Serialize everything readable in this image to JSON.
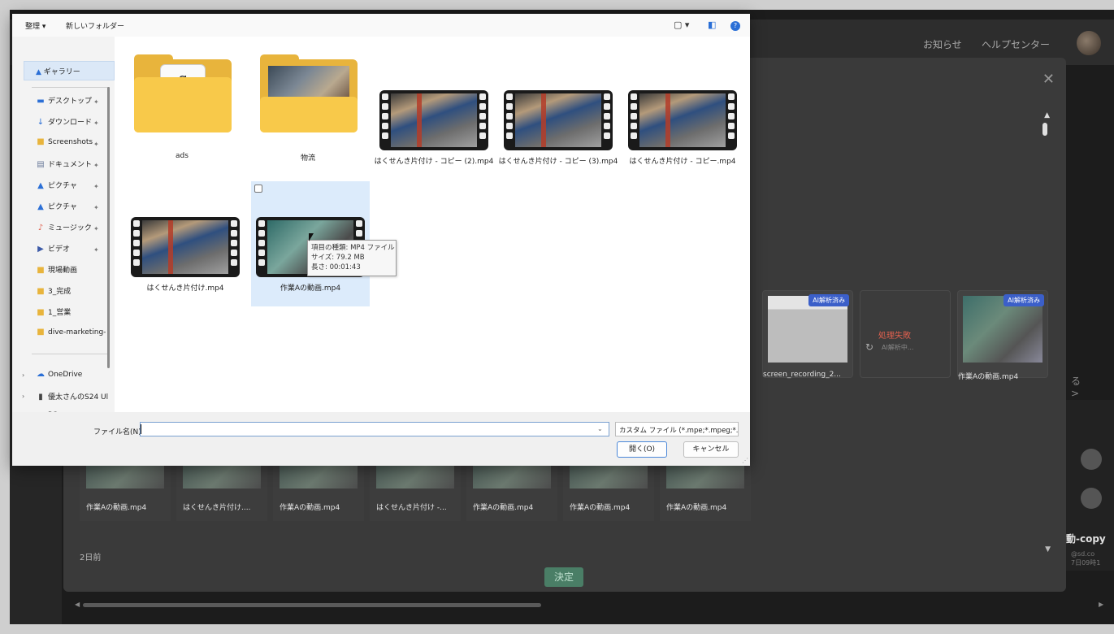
{
  "background_app": {
    "header": {
      "notice": "お知らせ",
      "help": "ヘルプセンター"
    },
    "ai_badge": "AI解析済み",
    "cards": [
      {
        "label": "screen_recording_2...",
        "badge": true
      },
      {
        "label": "",
        "failed_text": "処理失敗",
        "failed_sub": "AI解析中...",
        "badge": false
      },
      {
        "label": "作業Aの動画.mp4",
        "badge": true
      }
    ],
    "next_link": "る >",
    "bottom_tiles": [
      "作業Aの動画.mp4",
      "はくせんき片付け....",
      "作業Aの動画.mp4",
      "はくせんき片付け -...",
      "作業Aの動画.mp4",
      "作業Aの動画.mp4",
      "作業Aの動画.mp4"
    ],
    "day_label": "2日前",
    "confirm_label": "決定",
    "right_panel": {
      "title": "動-copy",
      "sub1": "@sd.co",
      "sub2": "7日09時1"
    }
  },
  "dialog": {
    "toolbar": {
      "organize": "整理 ▾",
      "new_folder": "新しいフォルダー"
    },
    "nav": {
      "gallery": "ギャラリー",
      "quick": [
        {
          "label": "デスクトップ",
          "icon": "▬"
        },
        {
          "label": "ダウンロード",
          "icon": "↓"
        },
        {
          "label": "Screenshots",
          "icon": "■"
        },
        {
          "label": "ドキュメント",
          "icon": "▤"
        },
        {
          "label": "ピクチャ",
          "icon": "▲"
        },
        {
          "label": "ピクチャ",
          "icon": "▲"
        },
        {
          "label": "ミュージック",
          "icon": "♪"
        },
        {
          "label": "ビデオ",
          "icon": "▶"
        },
        {
          "label": "現場動画",
          "icon": "■"
        },
        {
          "label": "3_完成",
          "icon": "■"
        },
        {
          "label": "1_営業",
          "icon": "■"
        },
        {
          "label": "dive-marketing-",
          "icon": "■"
        }
      ],
      "onedrive": "OneDrive",
      "phone": "優太さんのS24 Ul",
      "pc": "PC"
    },
    "files": [
      {
        "name": "ads",
        "type": "folder"
      },
      {
        "name": "物流",
        "type": "folder-photo"
      },
      {
        "name": "はくせんき片付け - コピー (2).mp4",
        "type": "video"
      },
      {
        "name": "はくせんき片付け - コピー (3).mp4",
        "type": "video"
      },
      {
        "name": "はくせんき片付け - コピー.mp4",
        "type": "video"
      },
      {
        "name": "はくせんき片付け.mp4",
        "type": "video"
      },
      {
        "name": "作業Aの動画.mp4",
        "type": "video-teal",
        "selected": true
      }
    ],
    "folder_glyph": "ɑ",
    "tooltip": {
      "type": "項目の種類: MP4 ファイル",
      "size": "サイズ: 79.2 MB",
      "length": "長さ: 00:01:43"
    },
    "footer": {
      "filename_label": "ファイル名(N):",
      "filename_value": "",
      "filter": "カスタム ファイル (*.mpe;*.mpeg;*.",
      "open": "開く(O)",
      "cancel": "キャンセル"
    }
  }
}
